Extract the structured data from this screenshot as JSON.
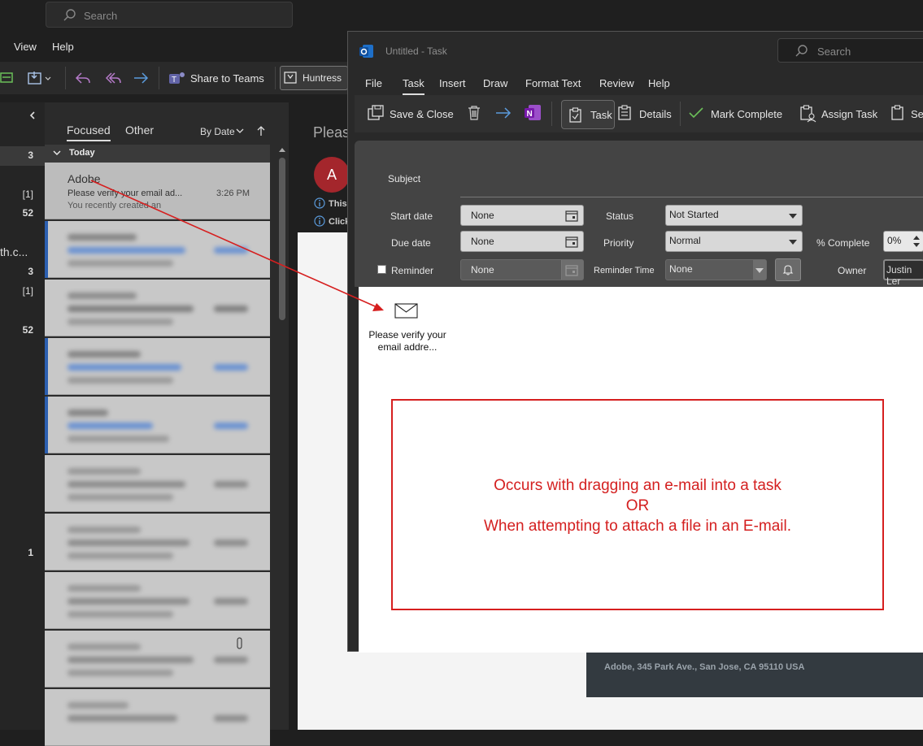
{
  "bg": {
    "search_placeholder": "Search",
    "menu": [
      "View",
      "Help"
    ],
    "share_label": "Share to Teams",
    "huntress_label": "Huntress",
    "folder_counts": [
      "3",
      "[1]",
      "52",
      "th.c...",
      "3",
      "[1]",
      "52",
      "1"
    ],
    "tabs": {
      "focused": "Focused",
      "other": "Other",
      "sort": "By Date"
    },
    "group_today": "Today",
    "first_msg": {
      "from": "Adobe",
      "subject": "Please verify your email ad...",
      "preview": "You recently created an",
      "time": "3:26 PM"
    },
    "blurred_times": [
      "",
      "",
      "",
      "",
      "",
      "",
      "",
      "",
      "",
      ""
    ],
    "reading": {
      "title": "Pleas",
      "avatar": "A",
      "line1": "This",
      "line2": "Click",
      "footer": "Adobe, 345 Park Ave., San Jose, CA 95110 USA"
    }
  },
  "task": {
    "title": "Untitled  -  Task",
    "search_placeholder": "Search",
    "menu": [
      "File",
      "Task",
      "Insert",
      "Draw",
      "Format Text",
      "Review",
      "Help"
    ],
    "ribbon": {
      "save_close": "Save & Close",
      "task": "Task",
      "details": "Details",
      "mark_complete": "Mark Complete",
      "assign_task": "Assign Task",
      "send": "Se"
    },
    "form": {
      "subject_label": "Subject",
      "start_label": "Start date",
      "start_value": "None",
      "due_label": "Due date",
      "due_value": "None",
      "status_label": "Status",
      "status_value": "Not Started",
      "priority_label": "Priority",
      "priority_value": "Normal",
      "pct_label": "% Complete",
      "pct_value": "0%",
      "reminder_label": "Reminder",
      "reminder_value": "None",
      "reminder_time_label": "Reminder Time",
      "reminder_time_value": "None",
      "owner_label": "Owner",
      "owner_value": "Justin Ler"
    },
    "attachment_label": "Please verify your email addre...",
    "note": {
      "line1": "Occurs with dragging an e-mail into a task",
      "line2": "OR",
      "line3": "When attempting to attach a file in an E-mail."
    }
  },
  "colors": {
    "annotation": "#d61f1f",
    "unread_bar": "#2c5fb0",
    "avatar": "#a4262c"
  }
}
